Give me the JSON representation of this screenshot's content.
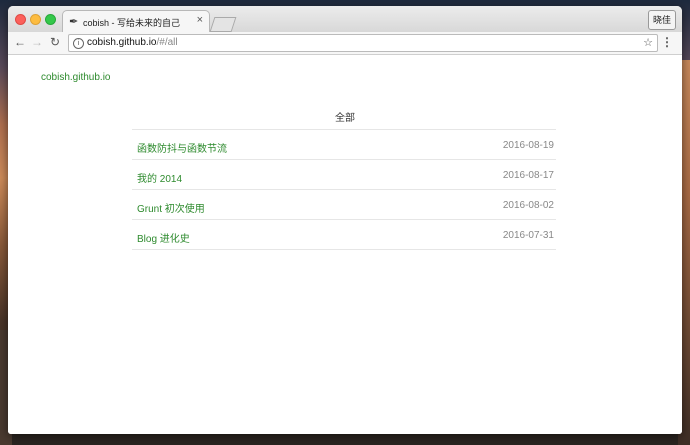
{
  "browser": {
    "tab_title": "cobish - 写给未来的自己",
    "tab_favicon": "feather-icon",
    "tab_close": "×",
    "profile_label": "晓佳",
    "url_host": "cobish.github.io",
    "url_path": "/#/all"
  },
  "site": {
    "brand": "cobish.github.io",
    "section_title": "全部"
  },
  "posts": [
    {
      "title": "函数防抖与函数节流",
      "date": "2016-08-19"
    },
    {
      "title": "我的 2014",
      "date": "2016-08-17"
    },
    {
      "title": "Grunt 初次使用",
      "date": "2016-08-02"
    },
    {
      "title": "Blog 进化史",
      "date": "2016-07-31"
    }
  ],
  "colors": {
    "link": "#2d8a2d",
    "date": "#888888"
  }
}
